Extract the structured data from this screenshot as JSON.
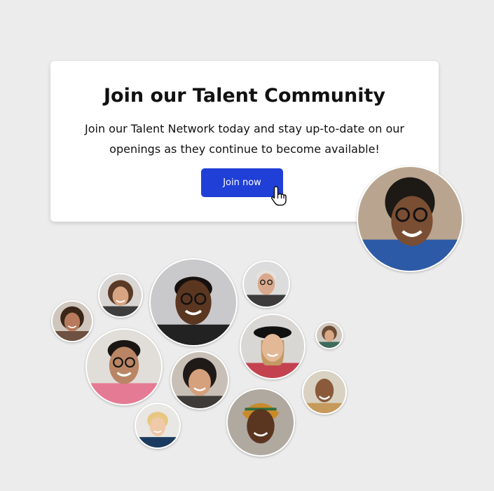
{
  "card": {
    "title": "Join our Talent Community",
    "description": "Join our Talent Network today and stay up-to-date on our openings as they continue to become available!",
    "button_label": "Join now"
  },
  "colors": {
    "background": "#ececec",
    "card": "#ffffff",
    "button": "#1f3fd6",
    "button_text": "#ffffff"
  },
  "icons": [
    "pointer-hand-cursor-icon",
    "person-avatar-icon"
  ]
}
